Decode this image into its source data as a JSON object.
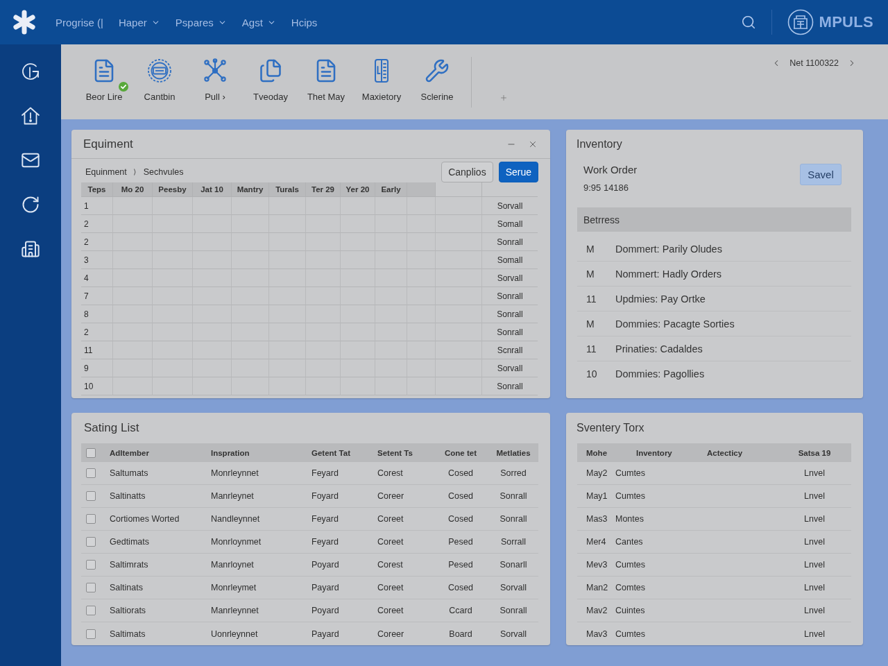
{
  "top_bar": {
    "nav": [
      {
        "label": "Progrise (|",
        "has_menu": false
      },
      {
        "label": "Haper",
        "has_menu": true
      },
      {
        "label": "Pspares",
        "has_menu": true
      },
      {
        "label": "Agst",
        "has_menu": true
      },
      {
        "label": "Hcips",
        "has_menu": false
      }
    ],
    "brand": "MPULS"
  },
  "toolbar": {
    "items": [
      {
        "label": "Beor Lire",
        "verified": true
      },
      {
        "label": "Cantbin",
        "verified": false
      },
      {
        "label": "Pull ›",
        "verified": false
      },
      {
        "label": "Tveoday",
        "verified": false
      },
      {
        "label": "Thet May",
        "verified": false
      },
      {
        "label": "Maxietory",
        "verified": false
      },
      {
        "label": "Sclerine",
        "verified": false
      }
    ],
    "pager": "Net 1100322"
  },
  "equipment": {
    "title": "Equiment",
    "breadcrumb": [
      "Equinment",
      "Sechvules"
    ],
    "buttons": [
      {
        "label": "Canplios",
        "primary": false
      },
      {
        "label": "Serue",
        "primary": true
      }
    ],
    "columns": [
      "Teps",
      "Mo 20",
      "Peesby",
      "Jat 10",
      "Mantry",
      "Turals",
      "Ter 29",
      "Yer 20",
      "Early"
    ],
    "rows": [
      {
        "teps": "1",
        "column_12": "Sorvall"
      },
      {
        "teps": "2",
        "column_12": "Somall"
      },
      {
        "teps": "2",
        "column_12": "Sonrall"
      },
      {
        "teps": "3",
        "column_12": "Somall"
      },
      {
        "teps": "4",
        "column_12": "Sorvall"
      },
      {
        "teps": "7",
        "column_12": "Sonrall"
      },
      {
        "teps": "8",
        "column_12": "Sonrall"
      },
      {
        "teps": "2",
        "column_12": "Sonrall"
      },
      {
        "teps": "11",
        "column_12": "Scnrall"
      },
      {
        "teps": "9",
        "column_12": "Sorvall"
      },
      {
        "teps": "10",
        "column_12": "Sonrall"
      }
    ]
  },
  "inventory": {
    "title": "Inventory",
    "work_order": {
      "label": "Work Order",
      "number": "9:95 14186"
    },
    "save_button": "Savel",
    "section": "Betrress",
    "items": [
      {
        "code": "M",
        "text": "Dommert: Parily Oludes"
      },
      {
        "code": "M",
        "text": "Nommert: Hadly Orders"
      },
      {
        "code": "11",
        "text": "Updmies: Pay Ortke"
      },
      {
        "code": "M",
        "text": "Dommies: Pacagte Sorties"
      },
      {
        "code": "11",
        "text": "Prinaties: Cadaldes"
      },
      {
        "code": "10",
        "text": "Dommies: Pagollies"
      }
    ]
  },
  "sating_list": {
    "title": "Sating List",
    "select_all": {
      "checked": false
    },
    "columns": [
      "Adltember",
      "Inspration",
      "Getent Tat",
      "Setent Ts",
      "Cone tet",
      "Metlaties"
    ],
    "rows": [
      {
        "checked": false,
        "cells": [
          "Saltumats",
          "Monrleynnet",
          "Feyard",
          "Corest",
          "Cosed",
          "Sorred"
        ]
      },
      {
        "checked": false,
        "cells": [
          "Saltinatts",
          "Manrleynet",
          "Foyard",
          "Coreer",
          "Cosed",
          "Sonrall"
        ]
      },
      {
        "checked": false,
        "cells": [
          "Cortiomes Worted",
          "Nandleynnet",
          "Feyard",
          "Coreet",
          "Cosed",
          "Sonrall"
        ]
      },
      {
        "checked": false,
        "cells": [
          "Gedtimats",
          "Monrloynmet",
          "Feyard",
          "Coreet",
          "Pesed",
          "Sorrall"
        ]
      },
      {
        "checked": false,
        "cells": [
          "Saltimrats",
          "Manrloynet",
          "Poyard",
          "Corest",
          "Pesed",
          "Sonarll"
        ]
      },
      {
        "checked": false,
        "cells": [
          "Saltinats",
          "Monrleymet",
          "Payard",
          "Coreet",
          "Cosed",
          "Sorvall"
        ]
      },
      {
        "checked": false,
        "cells": [
          "Saltiorats",
          "Manrleynnet",
          "Poyard",
          "Coreet",
          "Ccard",
          "Sonrall"
        ]
      },
      {
        "checked": false,
        "cells": [
          "Saltimats",
          "Uonrleynnet",
          "Payard",
          "Coreer",
          "Board",
          "Sorvall"
        ]
      }
    ]
  },
  "sventery_torx": {
    "title": "Sventery Torx",
    "columns": [
      "Mohe",
      "Inventory",
      "Actecticy",
      "Satsa 19"
    ],
    "rows": [
      {
        "mohe": "May2",
        "inventory": "Cumtes",
        "satsa_19": "Lnvel"
      },
      {
        "mohe": "May1",
        "inventory": "Cumtes",
        "satsa_19": "Lnvel"
      },
      {
        "mohe": "Mas3",
        "inventory": "Montes",
        "satsa_19": "Lnvel"
      },
      {
        "mohe": "Mer4",
        "inventory": "Cantes",
        "satsa_19": "Lnvel"
      },
      {
        "mohe": "Mev3",
        "inventory": "Cumtes",
        "satsa_19": "Lnvel"
      },
      {
        "mohe": "Man2",
        "inventory": "Comtes",
        "satsa_19": "Lnvel"
      },
      {
        "mohe": "Mav2",
        "inventory": "Cuintes",
        "satsa_19": "Lnvel"
      },
      {
        "mohe": "Mav3",
        "inventory": "Cumtes",
        "satsa_19": "Lnvel"
      }
    ]
  }
}
